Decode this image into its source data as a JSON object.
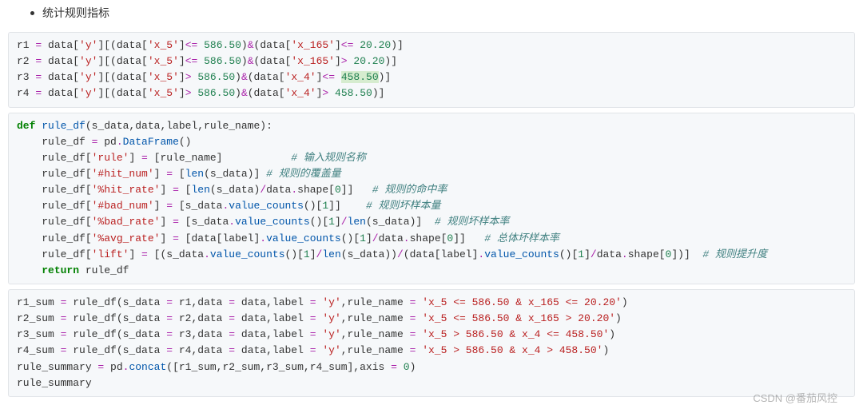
{
  "bullet": "统计规则指标",
  "comments": {
    "c1": "# 输入规则名称",
    "c2": "# 规则的覆盖量",
    "c3": "# 规则的命中率",
    "c4": "# 规则坏样本量",
    "c5": "# 规则坏样本率",
    "c6": "# 总体坏样本率",
    "c7": "# 规则提升度"
  },
  "code1": {
    "lines": [
      {
        "var": "r1",
        "col1": "'x_5'",
        "op1": "<=",
        "v1": "586.50",
        "col2": "'x_165'",
        "op2": "<=",
        "v2": "20.20"
      },
      {
        "var": "r2",
        "col1": "'x_5'",
        "op1": "<=",
        "v1": "586.50",
        "col2": "'x_165'",
        "op2": ">",
        "v2": "20.20"
      },
      {
        "var": "r3",
        "col1": "'x_5'",
        "op1": ">",
        "v1": "586.50",
        "col2": "'x_4'",
        "op2": "<=",
        "v2": "458.50",
        "hl": true
      },
      {
        "var": "r4",
        "col1": "'x_5'",
        "op1": ">",
        "v1": "586.50",
        "col2": "'x_4'",
        "op2": ">",
        "v2": "458.50"
      }
    ]
  },
  "code2": {
    "def_kw": "def",
    "fn": "rule_df",
    "params": "(s_data,data,label,rule_name):",
    "l1_a": "    rule_df ",
    "l1_b": " pd",
    "l1_c": "DataFrame",
    "l1_d": "()",
    "l2_a": "    rule_df[",
    "l2_s": "'rule'",
    "l2_b": "] ",
    "l2_c": " [rule_name]           ",
    "l3_a": "    rule_df[",
    "l3_s": "'#hit_num'",
    "l3_b": "] ",
    "l3_c": " [",
    "l3_len": "len",
    "l3_d": "(s_data)] ",
    "l4_a": "    rule_df[",
    "l4_s": "'%hit_rate'",
    "l4_b": "] ",
    "l4_c": " [",
    "l4_len": "len",
    "l4_d": "(s_data)",
    "l4_e": "data",
    "l4_f": "shape[",
    "l4_n": "0",
    "l4_g": "]]   ",
    "l5_a": "    rule_df[",
    "l5_s": "'#bad_num'",
    "l5_b": "] ",
    "l5_c": " [s_data",
    "l5_vc": "value_counts",
    "l5_d": "()[",
    "l5_n": "1",
    "l5_e": "]]    ",
    "l6_a": "    rule_df[",
    "l6_s": "'%bad_rate'",
    "l6_b": "] ",
    "l6_c": " [s_data",
    "l6_vc": "value_counts",
    "l6_d": "()[",
    "l6_n": "1",
    "l6_e": "]",
    "l6_len": "len",
    "l6_f": "(s_data)]  ",
    "l7_a": "    rule_df[",
    "l7_s": "'%avg_rate'",
    "l7_b": "] ",
    "l7_c": " [data[label]",
    "l7_vc": "value_counts",
    "l7_d": "()[",
    "l7_n": "1",
    "l7_e": "]",
    "l7_f": "data",
    "l7_g": "shape[",
    "l7_n2": "0",
    "l7_h": "]]   ",
    "l8_a": "    rule_df[",
    "l8_s": "'lift'",
    "l8_b": "] ",
    "l8_c": " [(s_data",
    "l8_vc": "value_counts",
    "l8_d": "()[",
    "l8_n": "1",
    "l8_e": "]",
    "l8_len": "len",
    "l8_f": "(s_data))",
    "l8_g": "(data[label]",
    "l8_vc2": "value_counts",
    "l8_h": "()[",
    "l8_n2": "1",
    "l8_i": "]",
    "l8_j": "data",
    "l8_k": "shape[",
    "l8_n3": "0",
    "l8_l": "])]  ",
    "ret_kw": "return",
    "ret_v": " rule_df"
  },
  "code3": {
    "lines": [
      {
        "var": "r1_sum",
        "s": "r1",
        "rule": "'x_5 <= 586.50 & x_165 <= 20.20'"
      },
      {
        "var": "r2_sum",
        "s": "r2",
        "rule": "'x_5 <= 586.50 & x_165 > 20.20'"
      },
      {
        "var": "r3_sum",
        "s": "r3",
        "rule": "'x_5 > 586.50 & x_4 <= 458.50'"
      },
      {
        "var": "r4_sum",
        "s": "r4",
        "rule": "'x_5 > 586.50 & x_4 > 458.50'"
      }
    ],
    "sum_a": "rule_summary ",
    "sum_b": " pd",
    "sum_c": "concat",
    "sum_d": "([r1_sum,r2_sum,r3_sum,r4_sum],axis ",
    "sum_n": "0",
    "sum_e": ")",
    "last": "rule_summary"
  },
  "literals": {
    "y": "'y'",
    "eq": "=",
    "amp": "&",
    "slash": "/",
    "dot": "."
  },
  "watermark": "CSDN @番茄风控"
}
